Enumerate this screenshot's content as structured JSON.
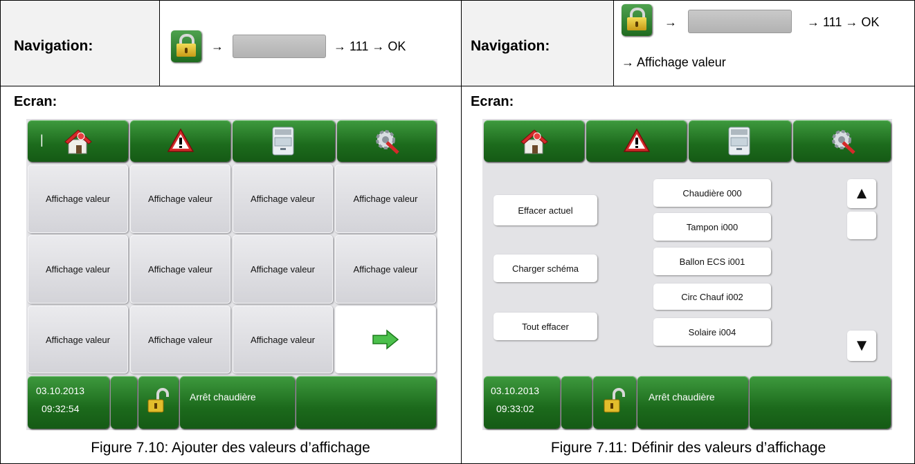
{
  "left": {
    "nav_label": "Navigation:",
    "nav_suffix": "→ 111 → OK",
    "ecran_label": "Ecran:",
    "caption": "Figure 7.10: Ajouter des valeurs d’affichage",
    "screen": {
      "tiles": [
        "Affichage valeur",
        "Affichage valeur",
        "Affichage valeur",
        "Affichage valeur",
        "Affichage valeur",
        "Affichage valeur",
        "Affichage valeur",
        "Affichage valeur",
        "Affichage valeur",
        "Affichage valeur",
        "Affichage valeur"
      ],
      "cursor_text": "|",
      "date": "03.10.2013",
      "time": "09:32:54",
      "status": "Arrêt chaudière"
    }
  },
  "right": {
    "nav_label": "Navigation:",
    "nav_suffix": "→ 111 → OK",
    "nav_line2": "→ Affichage valeur",
    "ecran_label": "Ecran:",
    "caption": "Figure 7.11: Définir des valeurs d’affichage",
    "screen": {
      "actions": [
        "Effacer actuel",
        "Charger schéma",
        "Tout effacer"
      ],
      "list": [
        "Chaudière 000",
        "Tampon i000",
        "Ballon ECS i001",
        "Circ Chauf i002",
        "Solaire i004"
      ],
      "date": "03.10.2013",
      "time": "09:33:02",
      "status": "Arrêt chaudière"
    }
  },
  "icons": {
    "nav_arrow": "→",
    "up": "▲",
    "down": "▼"
  }
}
